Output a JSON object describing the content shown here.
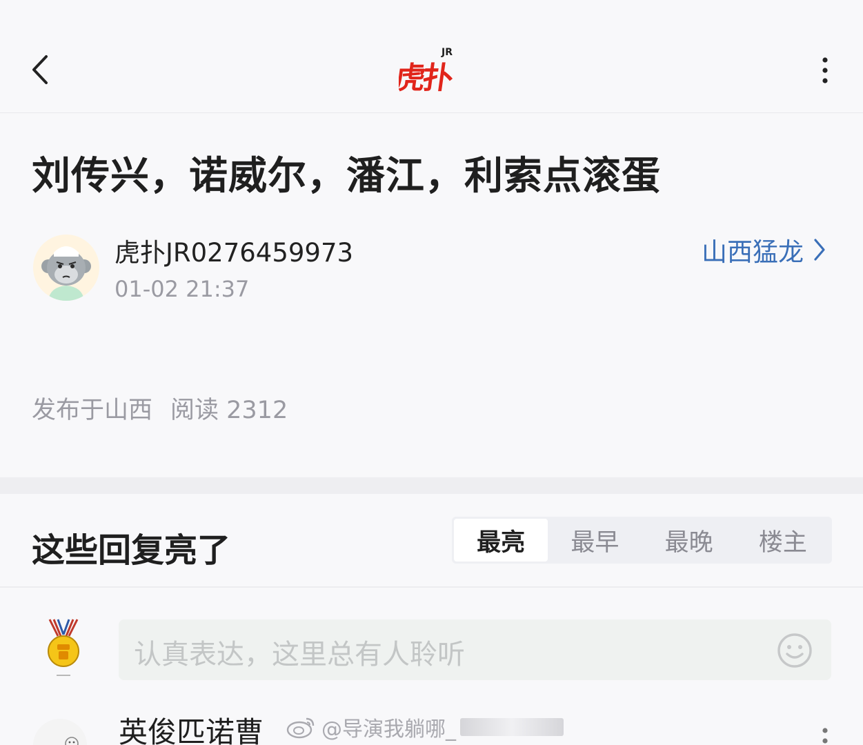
{
  "header": {
    "logo_main": "虎扑",
    "logo_sup": "JR",
    "back_icon": "chevron-left-icon",
    "more_icon": "vertical-ellipsis-icon"
  },
  "post": {
    "title": "刘传兴，诺威尔，潘江，利索点滚蛋",
    "author": "虎扑JR0276459973",
    "time": "01-02 21:37",
    "team": "山西猛龙",
    "location": "发布于山西",
    "reads": "阅读 2312"
  },
  "replies": {
    "title": "这些回复亮了",
    "tabs": [
      {
        "label": "最亮",
        "active": true
      },
      {
        "label": "最早",
        "active": false
      },
      {
        "label": "最晚",
        "active": false
      },
      {
        "label": "楼主",
        "active": false
      }
    ],
    "comment_placeholder": "认真表达，这里总有人聆听",
    "first_reply": {
      "name": "英俊匹诺曹"
    }
  },
  "watermark": {
    "text": "@导演我躺哪_"
  },
  "colors": {
    "brand_red": "#e1251b",
    "link_blue": "#3a6fb8",
    "background": "#f8f8fa"
  }
}
